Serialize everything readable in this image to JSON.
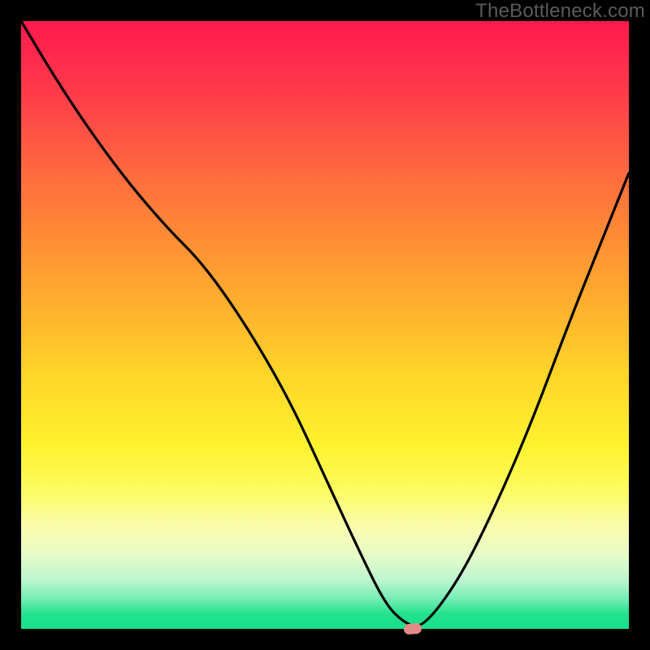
{
  "watermark": "TheBottleneck.com",
  "colors": {
    "background": "#000000",
    "curve": "#000000",
    "marker": "#e58a87"
  },
  "chart_data": {
    "type": "line",
    "title": "",
    "xlabel": "",
    "ylabel": "",
    "xlim": [
      0,
      100
    ],
    "ylim": [
      0,
      100
    ],
    "grid": false,
    "legend": false,
    "series": [
      {
        "name": "bottleneck-curve",
        "x": [
          0,
          6,
          12,
          18,
          24,
          30,
          37,
          44,
          50,
          56,
          60,
          63,
          66,
          72,
          78,
          84,
          90,
          96,
          100
        ],
        "y": [
          100,
          90,
          81,
          73,
          66,
          60,
          50,
          38,
          25,
          12,
          4,
          1,
          0,
          8,
          20,
          34,
          50,
          65,
          75
        ]
      }
    ],
    "marker": {
      "x": 64.5,
      "y": 0
    },
    "background_gradient": {
      "stops": [
        {
          "pos": 0.0,
          "color": "#ff1a4d"
        },
        {
          "pos": 0.25,
          "color": "#ff6a3f"
        },
        {
          "pos": 0.5,
          "color": "#ffba2d"
        },
        {
          "pos": 0.7,
          "color": "#fff22f"
        },
        {
          "pos": 0.85,
          "color": "#f7fcbb"
        },
        {
          "pos": 1.0,
          "color": "#18df8b"
        }
      ]
    }
  }
}
